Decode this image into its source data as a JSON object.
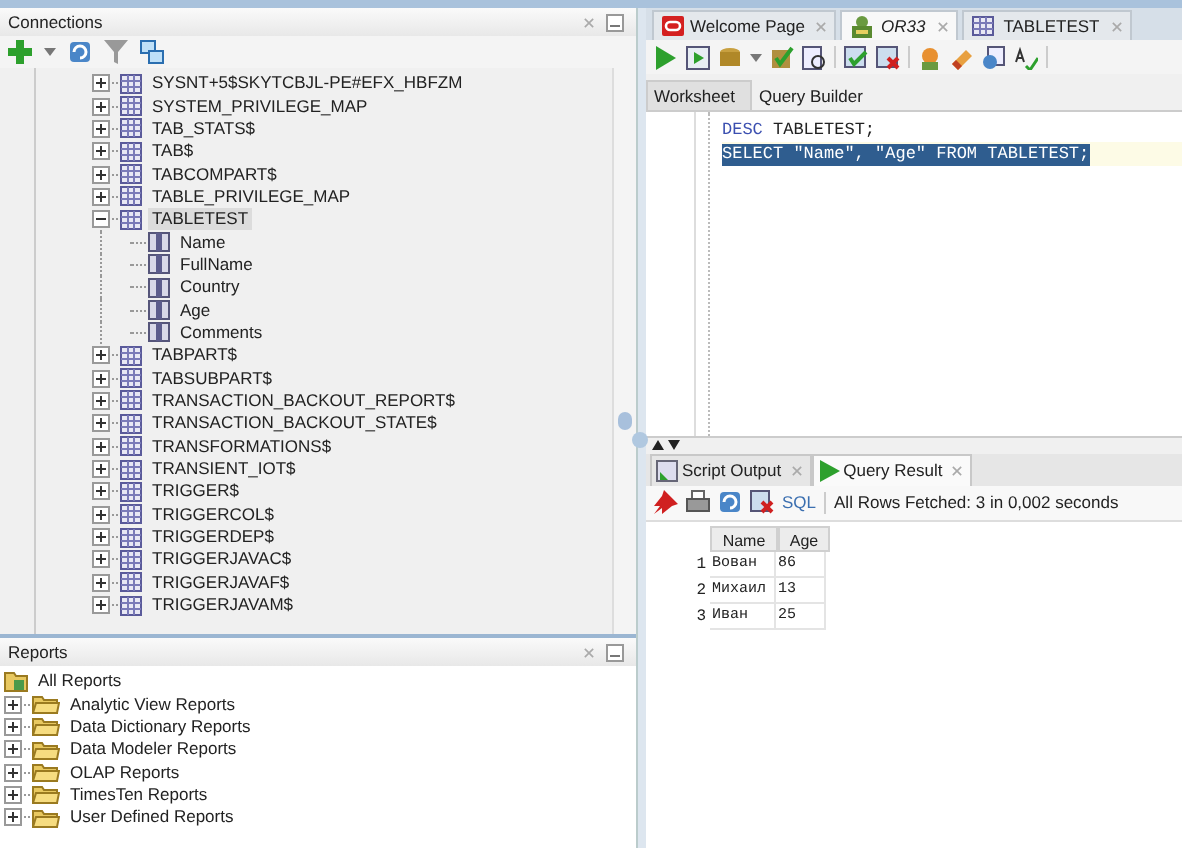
{
  "connections": {
    "title": "Connections",
    "tree": [
      {
        "label": "SYSNT+5$SKYTCBJL-PE#EFX_HBFZM",
        "kind": "table",
        "expanded": false,
        "selected": false
      },
      {
        "label": "SYSTEM_PRIVILEGE_MAP",
        "kind": "table",
        "expanded": false,
        "selected": false
      },
      {
        "label": "TAB_STATS$",
        "kind": "table",
        "expanded": false,
        "selected": false
      },
      {
        "label": "TAB$",
        "kind": "table",
        "expanded": false,
        "selected": false
      },
      {
        "label": "TABCOMPART$",
        "kind": "table",
        "expanded": false,
        "selected": false
      },
      {
        "label": "TABLE_PRIVILEGE_MAP",
        "kind": "table",
        "expanded": false,
        "selected": false
      },
      {
        "label": "TABLETEST",
        "kind": "table",
        "expanded": true,
        "selected": true,
        "children": [
          {
            "label": "Name",
            "kind": "column",
            "selected": false
          },
          {
            "label": "FullName",
            "kind": "column",
            "selected": false
          },
          {
            "label": "Country",
            "kind": "column",
            "selected": false
          },
          {
            "label": "Age",
            "kind": "column",
            "selected": false
          },
          {
            "label": "Comments",
            "kind": "column",
            "selected": false
          }
        ]
      },
      {
        "label": "TABPART$",
        "kind": "table",
        "expanded": false,
        "selected": false
      },
      {
        "label": "TABSUBPART$",
        "kind": "table",
        "expanded": false,
        "selected": false
      },
      {
        "label": "TRANSACTION_BACKOUT_REPORT$",
        "kind": "table",
        "expanded": false,
        "selected": false
      },
      {
        "label": "TRANSACTION_BACKOUT_STATE$",
        "kind": "table",
        "expanded": false,
        "selected": false
      },
      {
        "label": "TRANSFORMATIONS$",
        "kind": "table",
        "expanded": false,
        "selected": false
      },
      {
        "label": "TRANSIENT_IOT$",
        "kind": "table",
        "expanded": false,
        "selected": false
      },
      {
        "label": "TRIGGER$",
        "kind": "table",
        "expanded": false,
        "selected": false
      },
      {
        "label": "TRIGGERCOL$",
        "kind": "table",
        "expanded": false,
        "selected": false
      },
      {
        "label": "TRIGGERDEP$",
        "kind": "table",
        "expanded": false,
        "selected": false
      },
      {
        "label": "TRIGGERJAVAC$",
        "kind": "table",
        "expanded": false,
        "selected": false
      },
      {
        "label": "TRIGGERJAVAF$",
        "kind": "table",
        "expanded": false,
        "selected": false
      },
      {
        "label": "TRIGGERJAVAM$",
        "kind": "table",
        "expanded": false,
        "selected": false
      }
    ]
  },
  "reports": {
    "title": "Reports",
    "root": "All Reports",
    "items": [
      {
        "label": "Analytic View Reports",
        "expanded": false
      },
      {
        "label": "Data Dictionary Reports",
        "expanded": false
      },
      {
        "label": "Data Modeler Reports",
        "expanded": false
      },
      {
        "label": "OLAP Reports",
        "expanded": false
      },
      {
        "label": "TimesTen Reports",
        "expanded": false
      },
      {
        "label": "User Defined Reports",
        "expanded": false
      }
    ]
  },
  "editor_tabs": [
    {
      "label": "Welcome Page",
      "kind": "oracle",
      "selected": false
    },
    {
      "label": "OR33",
      "kind": "connection",
      "selected": true
    },
    {
      "label": "TABLETEST",
      "kind": "table",
      "selected": false
    }
  ],
  "worksheet_tabs": [
    {
      "label": "Worksheet",
      "selected": true
    },
    {
      "label": "Query Builder",
      "selected": false
    }
  ],
  "editor_lines": [
    {
      "selected": false,
      "tokens": [
        {
          "text": "DESC",
          "kind": "keyword"
        },
        {
          "text": " TABLETEST;",
          "kind": "plain"
        }
      ]
    },
    {
      "selected": true,
      "tokens": [
        {
          "text": "SELECT \"Name\", \"Age\" FROM TABLETEST;",
          "kind": "plain"
        }
      ]
    }
  ],
  "result_tabs": [
    {
      "label": "Script Output",
      "kind": "script",
      "selected": false
    },
    {
      "label": "Query Result",
      "kind": "query",
      "selected": true
    }
  ],
  "result_toolbar": {
    "sql_label": "SQL",
    "status": "All Rows Fetched: 3 in 0,002 seconds"
  },
  "result_grid": {
    "columns": [
      "Name",
      "Age"
    ],
    "rows": [
      {
        "number": "1",
        "cells": [
          "Вован",
          "86"
        ]
      },
      {
        "number": "2",
        "cells": [
          "Михаил",
          "13"
        ]
      },
      {
        "number": "3",
        "cells": [
          "Иван",
          "25"
        ]
      }
    ]
  }
}
